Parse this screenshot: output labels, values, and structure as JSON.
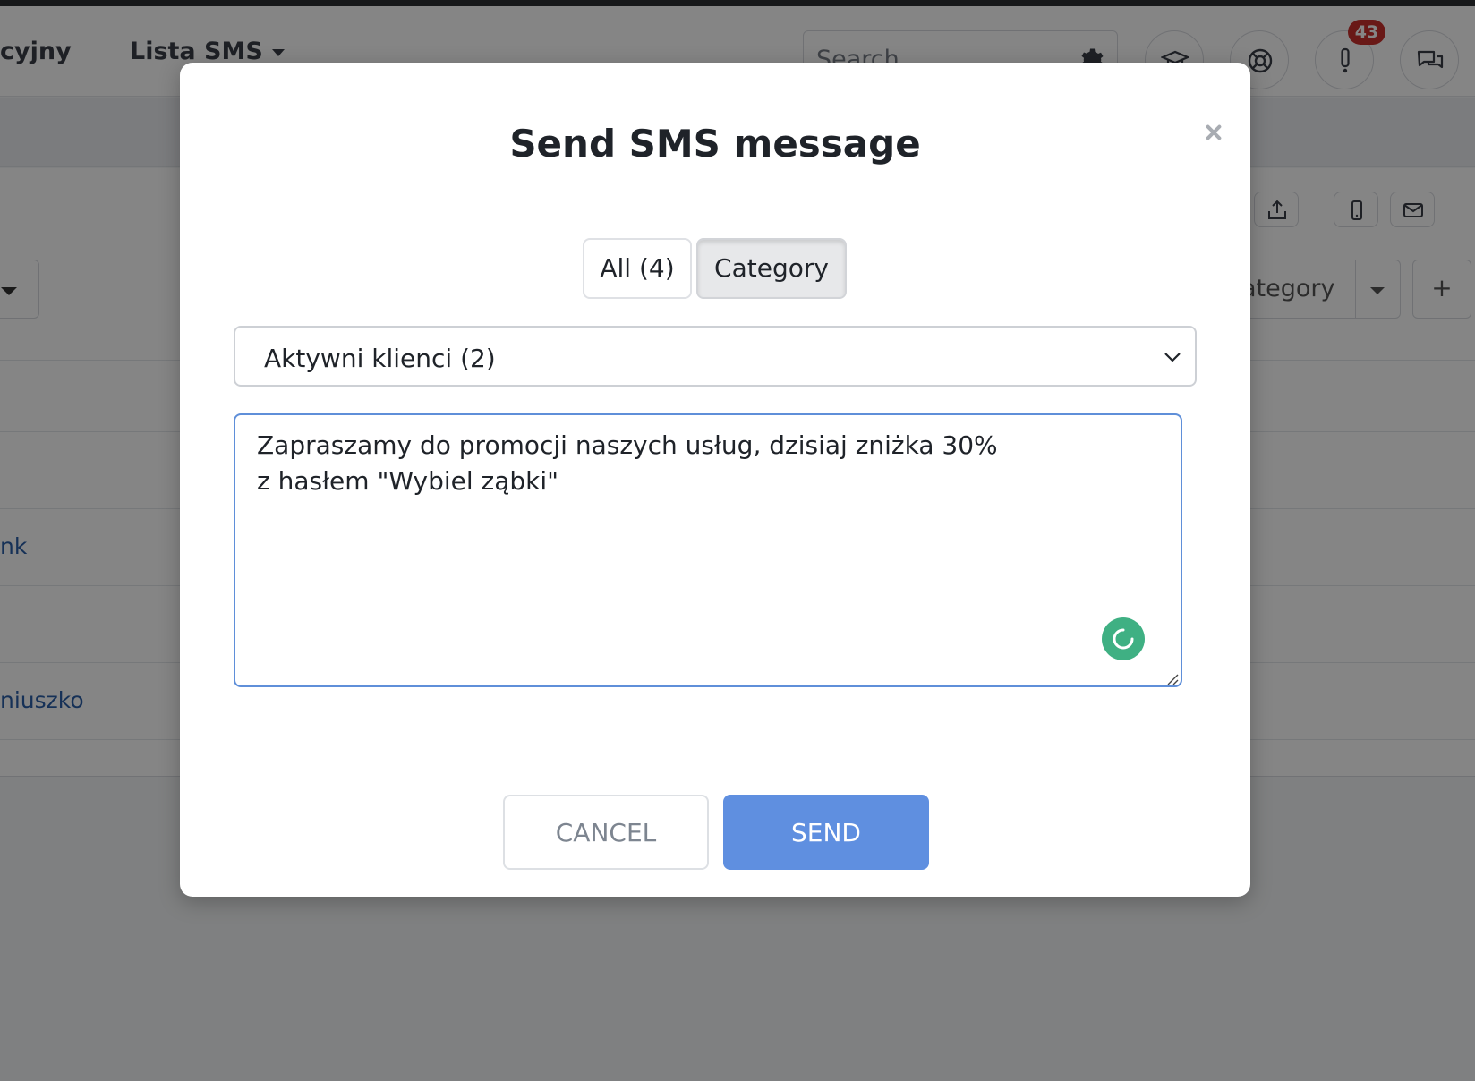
{
  "background": {
    "nav": {
      "left_partial": "cyjny",
      "menu_label": "Lista SMS",
      "search_placeholder": "Search",
      "notification_count": "43"
    },
    "right_dropdown_partial": "ategory",
    "plus_label": "+",
    "row_links": [
      "nk",
      "niuszko"
    ]
  },
  "modal": {
    "title": "Send SMS message",
    "tabs": [
      {
        "label": "All (4)",
        "active": false
      },
      {
        "label": "Category",
        "active": true
      }
    ],
    "category_select": {
      "value": "Aktywni klienci (2)"
    },
    "message": "Zapraszamy do promocji naszych usług, dzisiaj zniżka 30%\nz hasłem \"Wybiel ząbki\"",
    "buttons": {
      "cancel": "CANCEL",
      "send": "SEND"
    }
  },
  "colors": {
    "accent": "#5f8fe0",
    "overlay": "#808184",
    "badge": "#c9302c",
    "grammar_icon": "#3fb083"
  }
}
